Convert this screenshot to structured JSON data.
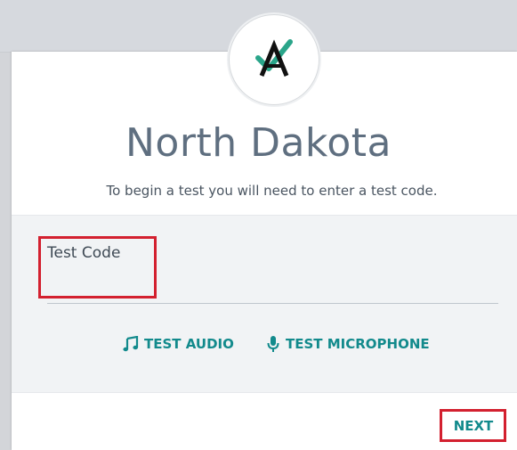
{
  "header": {
    "logo_icon": "airways-check-logo-icon",
    "title": "North Dakota",
    "subtitle": "To begin a test you will need to enter a test code."
  },
  "form": {
    "test_code_label": "Test Code",
    "test_code_value": "",
    "test_code_placeholder": ""
  },
  "actions": {
    "test_audio_label": "TEST AUDIO",
    "test_audio_icon": "music-note-icon",
    "test_microphone_label": "TEST MICROPHONE",
    "test_microphone_icon": "microphone-icon",
    "next_label": "NEXT"
  },
  "colors": {
    "accent": "#128a8c",
    "title": "#5f6f80",
    "highlight": "#d3202f",
    "logo_check": "#2aa58a"
  }
}
